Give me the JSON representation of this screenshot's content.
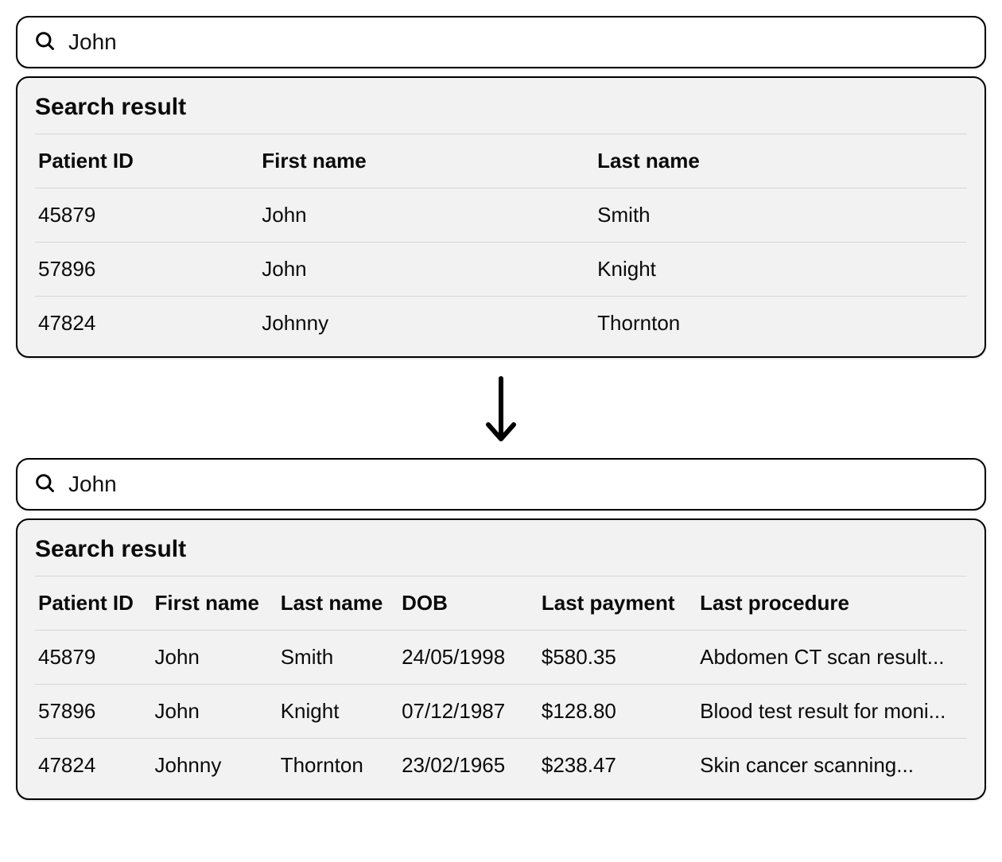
{
  "top": {
    "search_value": "John",
    "results_title": "Search result",
    "columns": {
      "patient_id": "Patient ID",
      "first_name": "First name",
      "last_name": "Last name"
    },
    "rows": [
      {
        "patient_id": "45879",
        "first_name": "John",
        "last_name": "Smith"
      },
      {
        "patient_id": "57896",
        "first_name": "John",
        "last_name": "Knight"
      },
      {
        "patient_id": "47824",
        "first_name": "Johnny",
        "last_name": "Thornton"
      }
    ]
  },
  "bottom": {
    "search_value": "John",
    "results_title": "Search result",
    "columns": {
      "patient_id": "Patient ID",
      "first_name": "First name",
      "last_name": "Last name",
      "dob": "DOB",
      "last_payment": "Last payment",
      "last_procedure": "Last procedure"
    },
    "rows": [
      {
        "patient_id": "45879",
        "first_name": "John",
        "last_name": "Smith",
        "dob": "24/05/1998",
        "last_payment": "$580.35",
        "last_procedure": "Abdomen CT scan result..."
      },
      {
        "patient_id": "57896",
        "first_name": "John",
        "last_name": "Knight",
        "dob": "07/12/1987",
        "last_payment": "$128.80",
        "last_procedure": "Blood test result for moni..."
      },
      {
        "patient_id": "47824",
        "first_name": "Johnny",
        "last_name": "Thornton",
        "dob": "23/02/1965",
        "last_payment": "$238.47",
        "last_procedure": "Skin cancer scanning..."
      }
    ]
  }
}
